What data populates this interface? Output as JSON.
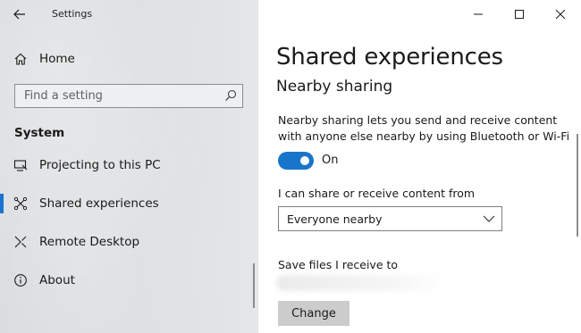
{
  "window": {
    "title": "Settings"
  },
  "sidebar": {
    "home_label": "Home",
    "search_placeholder": "Find a setting",
    "section_header": "System",
    "items": [
      {
        "label": "Projecting to this PC",
        "icon": "projector-icon",
        "selected": false
      },
      {
        "label": "Shared experiences",
        "icon": "share-network-icon",
        "selected": true
      },
      {
        "label": "Remote Desktop",
        "icon": "remote-desktop-icon",
        "selected": false
      },
      {
        "label": "About",
        "icon": "info-icon",
        "selected": false
      }
    ]
  },
  "main": {
    "page_title": "Shared experiences",
    "section_title": "Nearby sharing",
    "description": "Nearby sharing lets you send and receive content with anyone else nearby by using Bluetooth or Wi-Fi",
    "toggle": {
      "state": "On",
      "on": true
    },
    "share_from_label": "I can share or receive content from",
    "share_from_value": "Everyone nearby",
    "save_files_label": "Save files I receive to",
    "change_button": "Change"
  },
  "colors": {
    "accent": "#1975c9",
    "selection_bar": "#1874d0",
    "button_bg": "#cccccc"
  }
}
